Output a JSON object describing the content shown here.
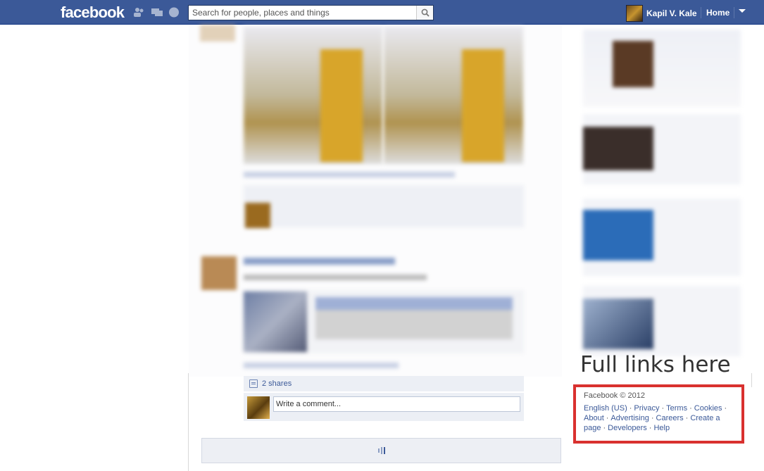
{
  "header": {
    "logo": "facebook",
    "search_placeholder": "Search for people, places and things",
    "user_name": "Kapil V. Kale",
    "home_label": "Home",
    "colors": {
      "bar": "#3b5998",
      "link": "#3b5998"
    },
    "icons": [
      "friend-requests-icon",
      "messages-icon",
      "notifications-icon",
      "search-icon",
      "caret-down-icon"
    ]
  },
  "post": {
    "shares_label": "2 shares",
    "comment_placeholder": "Write a comment..."
  },
  "annotation": "Full links here",
  "footer": {
    "copyright": "Facebook © 2012",
    "links": [
      "English (US)",
      "Privacy",
      "Terms",
      "Cookies",
      "About",
      "Advertising",
      "Careers",
      "Create a page",
      "Developers",
      "Help"
    ]
  }
}
